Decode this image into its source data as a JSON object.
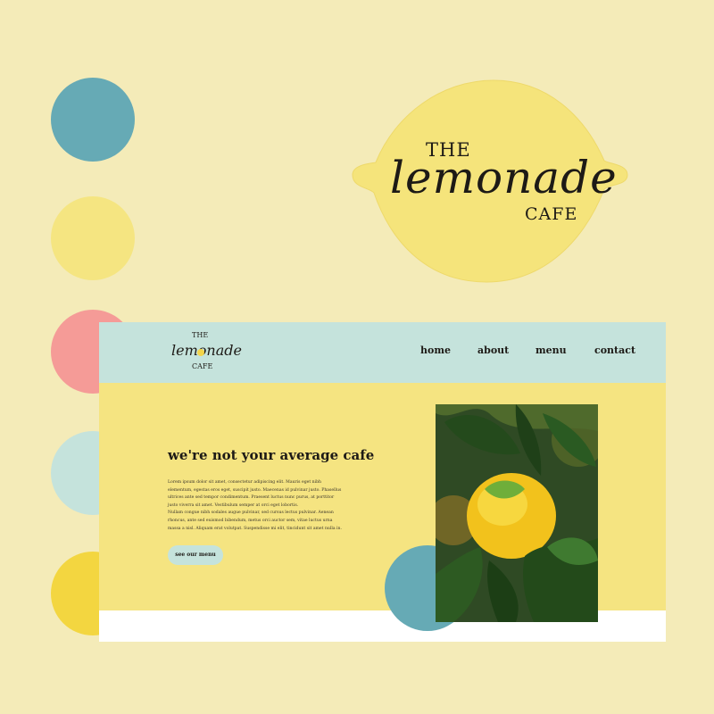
{
  "palette": {
    "colors": [
      "#66aab5",
      "#f5e581",
      "#f59b97",
      "#c5e3dc",
      "#f3d640"
    ]
  },
  "brand_logo": {
    "line1": "THE",
    "script": "lemonade",
    "line2": "CAFE"
  },
  "site": {
    "nav": {
      "logo": {
        "line1": "THE",
        "script": "lemonade",
        "line2": "CAFE"
      },
      "links": [
        "home",
        "about",
        "menu",
        "contact"
      ]
    },
    "hero": {
      "title": "we're not your average cafe",
      "body_1": "Lorem ipsum dolor sit amet, consectetur adipiscing elit. Mauris eget nibh elementum, egestas eros eget, suscipit justo. Maecenas id pulvinar justo. Phasellus ultrices ante sed tempor condimentum. Praesent luctus nunc purus, at porttitor justo viverra sit amet. Vestibulum semper at orci eget lobortis.",
      "body_2": "Nullam congue nibh sodales augue pulvinar, sed cursus lectus pulvinar. Aenean rhoncus, ante sed euismod bibendum, metus orci auctor sem, vitae luctus urna massa a nisl. Aliquam erat volutpat. Suspendisse mi elit, tincidunt sit amet nulla in.",
      "cta_label": "see our menu",
      "image_subject": "lemon-on-tree"
    }
  }
}
